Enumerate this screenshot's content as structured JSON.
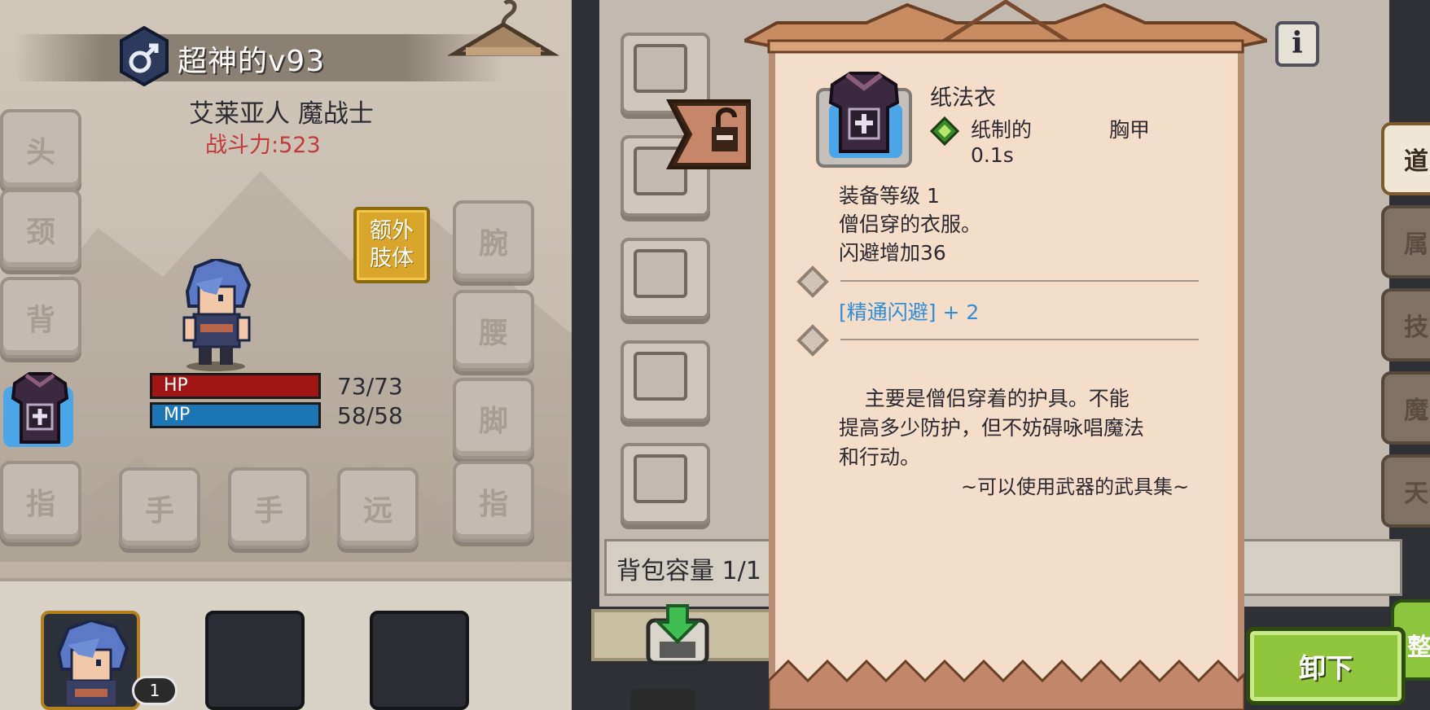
{
  "character": {
    "name": "超神的v93",
    "race_class": "艾莱亚人 魔战士",
    "combat_power": "战斗力:523",
    "hp": {
      "label": "HP",
      "value": "73/73",
      "fraction": 1.0
    },
    "mp": {
      "label": "MP",
      "value": "58/58",
      "fraction": 1.0
    }
  },
  "equip_slots": {
    "head": "头",
    "neck": "颈",
    "back": "背",
    "wrist": "腕",
    "waist": "腰",
    "feet": "脚",
    "finger_left": "指",
    "hand_left": "手",
    "hand_right": "手",
    "distant": "远",
    "finger_right": "指",
    "extra_limb": "额外肢体"
  },
  "party": {
    "level_badge": "1"
  },
  "inventory": {
    "capacity_label": "背包容量 1/1"
  },
  "side_tabs": [
    "道",
    "属",
    "技",
    "魔",
    "天"
  ],
  "sort_button": "整",
  "tooltip": {
    "item_name": "纸法衣",
    "material": "纸制的",
    "slot_type": "胸甲",
    "weight": "0.1s",
    "equip_level": "装备等级 1",
    "description": "僧侣穿的衣服。",
    "evasion_bonus": "闪避增加36",
    "skill_bonus": "[精通闪避] + 2",
    "lore": "    主要是僧侣穿着的护具。不能\n提高多少防护，但不妨碍咏唱魔法\n和行动。",
    "set_name": "~可以使用武器的武具集~"
  },
  "actions": {
    "unequip": "卸下",
    "info": "i"
  },
  "colors": {
    "hp": "#a11515",
    "mp": "#1c76b6",
    "skill_text": "#2f8fd6",
    "combat_power": "#c33a3a",
    "unequip_button": "#8fc63c"
  }
}
